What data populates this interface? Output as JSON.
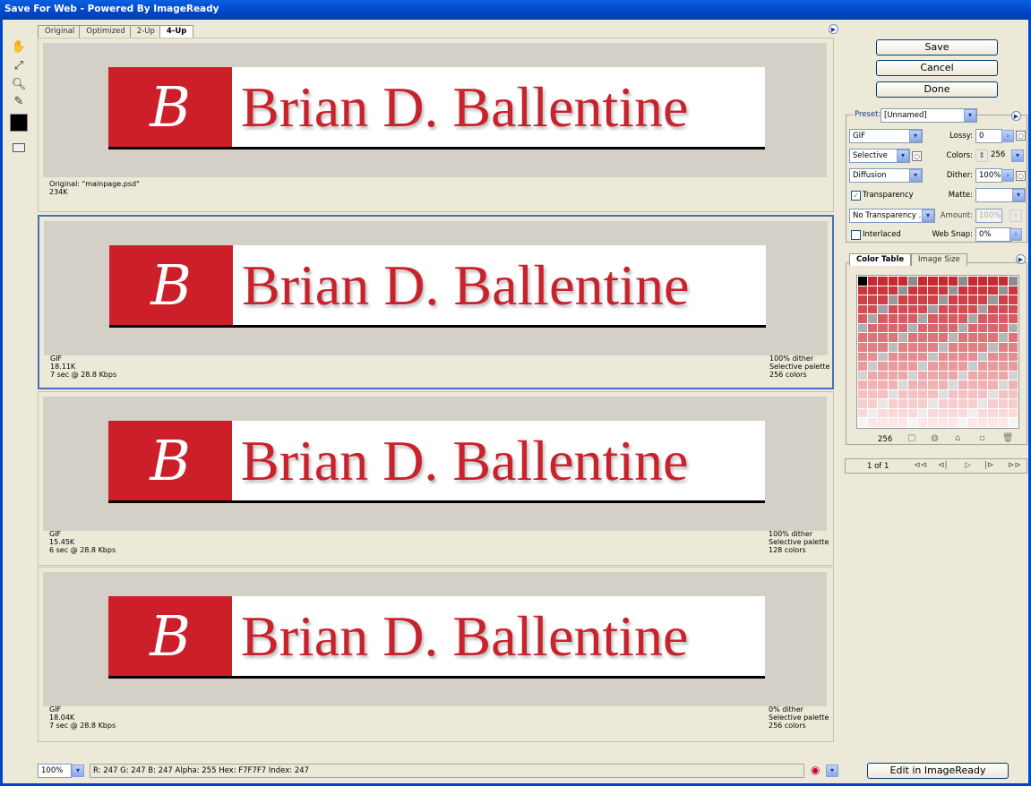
{
  "window": {
    "title": "Save For Web - Powered By ImageReady"
  },
  "tabs": [
    {
      "label": "Original",
      "active": false
    },
    {
      "label": "Optimized",
      "active": false
    },
    {
      "label": "2-Up",
      "active": false
    },
    {
      "label": "4-Up",
      "active": true
    }
  ],
  "tools": [
    "hand-icon",
    "slice-select-icon",
    "zoom-icon",
    "eyedropper-icon",
    "color-swatch-icon",
    "toggle-slices-icon"
  ],
  "banner": {
    "initial": "B",
    "name": "Brian D. Ballentine"
  },
  "views": [
    {
      "left": [
        "Original: \"mainpage.psd\"",
        "234K"
      ],
      "right": []
    },
    {
      "left": [
        "GIF",
        "18.11K",
        "7 sec @ 28.8 Kbps"
      ],
      "right": [
        "100% dither",
        "Selective palette",
        "256 colors"
      ]
    },
    {
      "left": [
        "GIF",
        "15.45K",
        "6 sec @ 28.8 Kbps"
      ],
      "right": [
        "100% dither",
        "Selective palette",
        "128 colors"
      ]
    },
    {
      "left": [
        "GIF",
        "18.04K",
        "7 sec @ 28.8 Kbps"
      ],
      "right": [
        "0% dither",
        "Selective palette",
        "256 colors"
      ]
    }
  ],
  "buttons": {
    "save": "Save",
    "cancel": "Cancel",
    "done": "Done",
    "edit": "Edit in ImageReady"
  },
  "settings": {
    "preset_label": "Preset:",
    "preset_value": "[Unnamed]",
    "format": "GIF",
    "lossy_label": "Lossy:",
    "lossy": "0",
    "palette": "Selective",
    "colors_label": "Colors:",
    "colors": "256",
    "dither_algo": "Diffusion",
    "dither_label": "Dither:",
    "dither": "100%",
    "transparency_label": "Transparency",
    "transparency_checked": true,
    "matte_label": "Matte:",
    "matte": "",
    "trans_dither": "No Transparency ...",
    "amount_label": "Amount:",
    "amount": "100%",
    "interlaced_label": "Interlaced",
    "interlaced_checked": false,
    "websnap_label": "Web Snap:",
    "websnap": "0%"
  },
  "color_table": {
    "tab1": "Color Table",
    "tab2": "Image Size",
    "count": "256"
  },
  "paging": {
    "label": "1 of 1"
  },
  "status": {
    "zoom": "100%",
    "readout": "R:  247   G:  247   B:  247   Alpha:  255  Hex:   F7F7F7  Index:   247"
  }
}
